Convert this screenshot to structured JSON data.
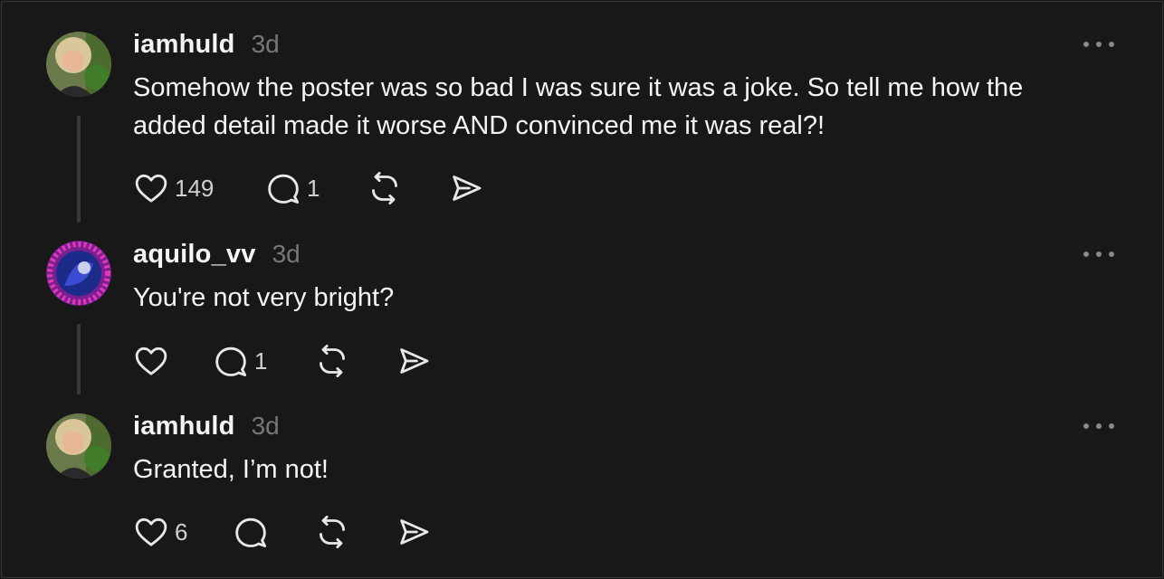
{
  "posts": [
    {
      "username": "iamhuld",
      "time": "3d",
      "text_lines": [
        "Somehow the poster was so bad I was sure it was a joke. So tell me how the",
        "added detail made it worse AND convinced me it was real?!"
      ],
      "likes": "149",
      "replies": "1"
    },
    {
      "username": "aquilo_vv",
      "time": "3d",
      "text_lines": [
        "You're not very bright?"
      ],
      "likes": "",
      "replies": "1"
    },
    {
      "username": "iamhuld",
      "time": "3d",
      "text_lines": [
        "Granted, I’m not!"
      ],
      "likes": "6",
      "replies": ""
    }
  ],
  "icons": {
    "like": "heart-icon",
    "reply": "comment-icon",
    "repost": "repost-icon",
    "share": "send-icon",
    "more": "more-icon"
  },
  "colors": {
    "background": "#181818",
    "text": "#f3f5f7",
    "muted": "#777777",
    "thread_line": "#3a3a3a"
  }
}
